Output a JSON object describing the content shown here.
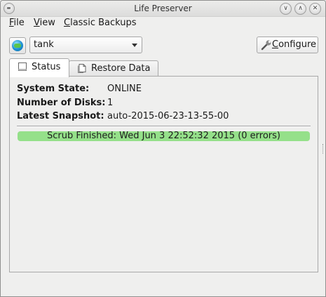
{
  "window": {
    "title": "Life Preserver"
  },
  "menubar": [
    {
      "label": "File",
      "mnemonic": "F",
      "rest": "ile"
    },
    {
      "label": "View",
      "mnemonic": "V",
      "rest": "iew"
    },
    {
      "label": "Classic Backups",
      "mnemonic": "C",
      "rest": "lassic Backups"
    }
  ],
  "toolbar": {
    "pool_selected": "tank",
    "configure_label": "Configure",
    "configure_mnemonic": "C",
    "configure_rest": "onfigure"
  },
  "tabs": [
    {
      "label": "Status",
      "active": true
    },
    {
      "label": "Restore Data",
      "active": false
    }
  ],
  "status": {
    "fields": [
      {
        "key": "System State:",
        "value": "ONLINE"
      },
      {
        "key": "Number of Disks:",
        "value": "1"
      },
      {
        "key": "Latest Snapshot:",
        "value": "auto-2015-06-23-13-55-00"
      }
    ],
    "scrub_text": "Scrub Finished: Wed Jun 3 22:52:32 2015 (0 errors)",
    "scrub_color": "#95e08a"
  },
  "icons": {
    "app": "lifepreserver-icon",
    "wrench": "wrench-icon",
    "status_tab": "status-page-icon",
    "restore_tab": "document-icon"
  }
}
